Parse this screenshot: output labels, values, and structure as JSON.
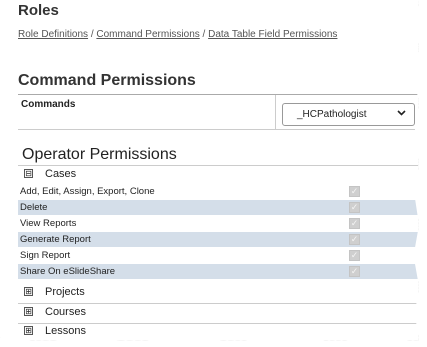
{
  "page": {
    "title": "Roles"
  },
  "breadcrumb": {
    "items": [
      "Role Definitions",
      "Command Permissions",
      "Data Table Field Permissions"
    ],
    "separator": "/"
  },
  "command_permissions": {
    "heading": "Command Permissions",
    "column_label": "Commands",
    "selected_role": "_HCPathologist",
    "chevron_icon": "chevron-down-icon"
  },
  "operator_permissions": {
    "heading": "Operator Permissions",
    "groups": [
      {
        "label": "Cases",
        "toggle": "⊟",
        "expanded": true,
        "permissions": [
          {
            "label": "Add, Edit, Assign, Export, Clone",
            "checked": true,
            "disabled": true
          },
          {
            "label": "Delete",
            "checked": true,
            "disabled": true
          },
          {
            "label": "View Reports",
            "checked": true,
            "disabled": true
          },
          {
            "label": "Generate Report",
            "checked": true,
            "disabled": true
          },
          {
            "label": "Sign Report",
            "checked": true,
            "disabled": true
          },
          {
            "label": "Share On eSlideShare",
            "checked": true,
            "disabled": true
          }
        ]
      },
      {
        "label": "Projects",
        "toggle": "⊞",
        "expanded": false
      },
      {
        "label": "Courses",
        "toggle": "⊞",
        "expanded": false
      },
      {
        "label": "Lessons",
        "toggle": "⊞",
        "expanded": false
      }
    ]
  },
  "colors": {
    "alt_row": "#d4dee9",
    "text": "#222222",
    "disabled_checkbox": "#cfcfcf"
  }
}
